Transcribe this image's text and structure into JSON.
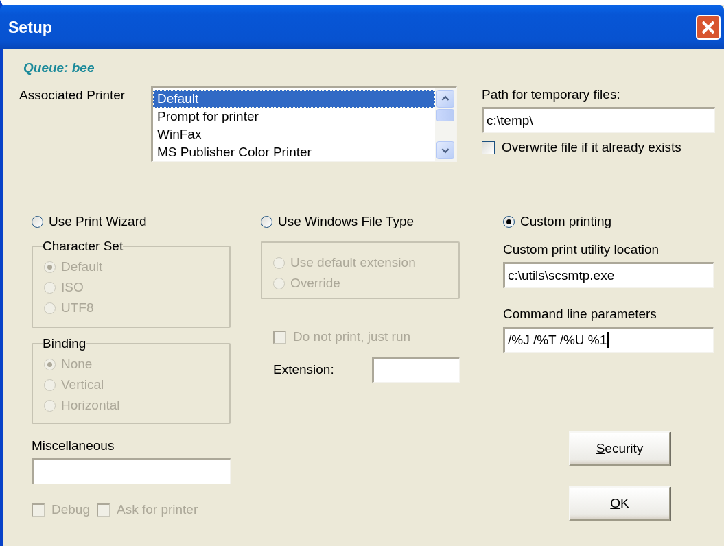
{
  "window": {
    "title": "Setup"
  },
  "queue_label": "Queue: bee",
  "associated_printer": {
    "label": "Associated Printer",
    "items": [
      {
        "label": "Default",
        "selected": true
      },
      {
        "label": "Prompt for printer",
        "selected": false
      },
      {
        "label": "WinFax",
        "selected": false
      },
      {
        "label": "MS Publisher Color Printer",
        "selected": false
      }
    ]
  },
  "temp_path": {
    "label": "Path for temporary files:",
    "value": "c:\\temp\\"
  },
  "overwrite": {
    "label": "Overwrite file if it already exists",
    "checked": false
  },
  "modes": [
    {
      "label": "Use Print Wizard",
      "selected": false
    },
    {
      "label": "Use Windows File Type",
      "selected": false
    },
    {
      "label": "Custom printing",
      "selected": true
    }
  ],
  "character_set": {
    "title": "Character Set",
    "options": [
      {
        "label": "Default",
        "selected": true,
        "disabled": true
      },
      {
        "label": "ISO",
        "selected": false,
        "disabled": true
      },
      {
        "label": "UTF8",
        "selected": false,
        "disabled": true
      }
    ]
  },
  "binding": {
    "title": "Binding",
    "options": [
      {
        "label": "None",
        "selected": true,
        "disabled": true
      },
      {
        "label": "Vertical",
        "selected": false,
        "disabled": true
      },
      {
        "label": "Horizontal",
        "selected": false,
        "disabled": true
      }
    ]
  },
  "miscellaneous": {
    "label": "Miscellaneous"
  },
  "bottom_checks": [
    {
      "label": "Debug",
      "checked": false,
      "disabled": true
    },
    {
      "label": "Ask for printer",
      "checked": false,
      "disabled": true
    }
  ],
  "extension_options": [
    {
      "label": "Use default extension",
      "selected": false,
      "disabled": true
    },
    {
      "label": "Override",
      "selected": false,
      "disabled": true
    }
  ],
  "do_not_print": {
    "label": "Do not print, just run",
    "checked": false,
    "disabled": true
  },
  "extension": {
    "label": "Extension:"
  },
  "custom_utility": {
    "label": "Custom print utility location",
    "value": "c:\\utils\\scsmtp.exe"
  },
  "command_line": {
    "label": "Command line parameters",
    "value": "/%J /%T /%U %1",
    "focused": true
  },
  "buttons": [
    {
      "label": "Security",
      "mnemonic_underlined": true
    },
    {
      "label": "OK",
      "mnemonic_underlined": true
    }
  ]
}
